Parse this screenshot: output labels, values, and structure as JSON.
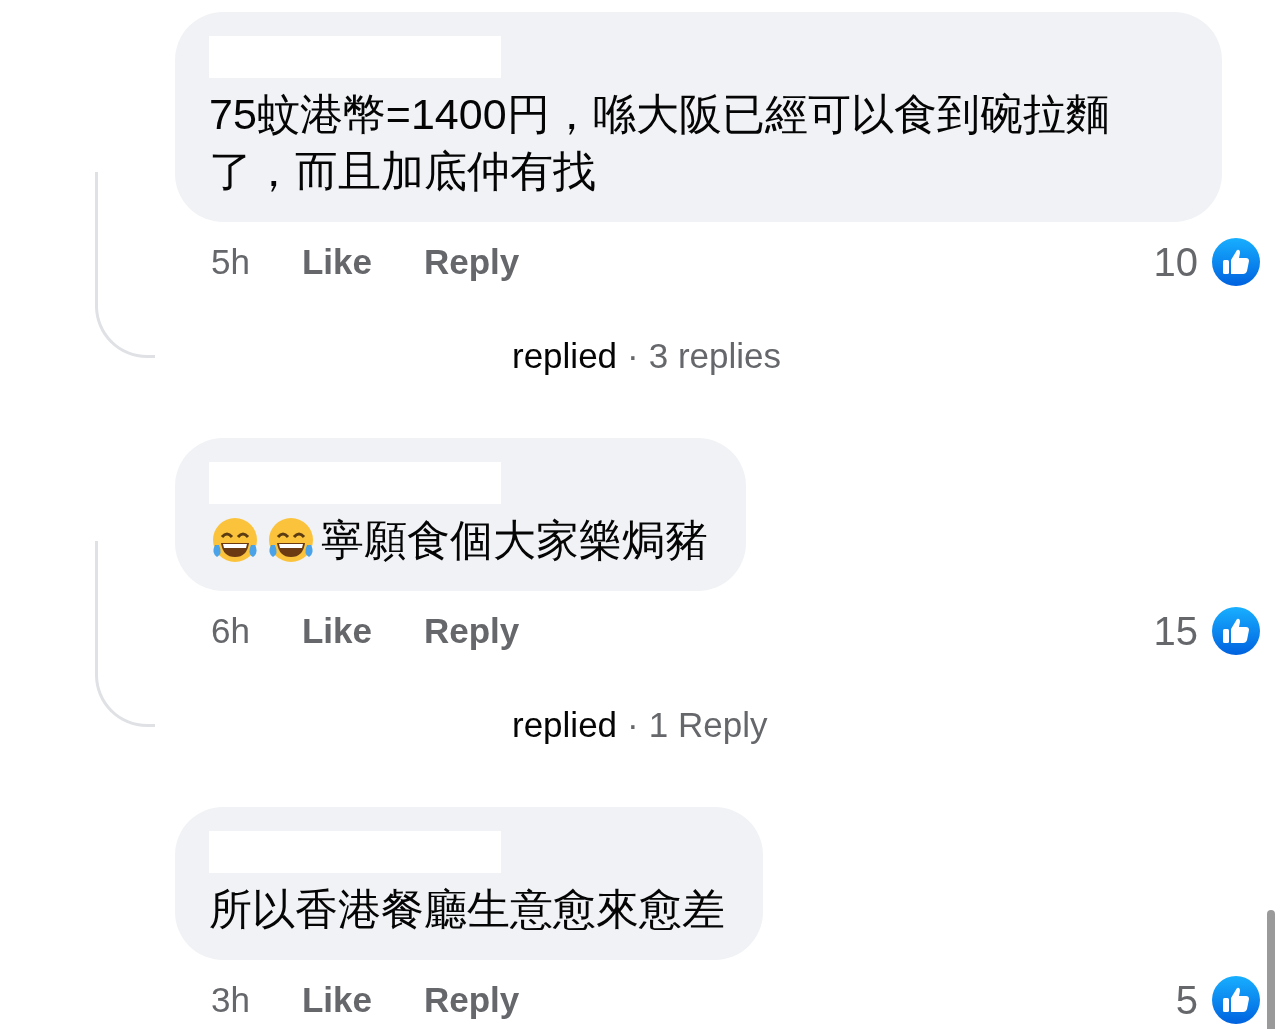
{
  "comments": [
    {
      "author_hidden": true,
      "text": "75蚊港幣=1400円，喺大阪已經可以食到碗拉麵了，而且加底仲有找",
      "time": "5h",
      "like_label": "Like",
      "reply_label": "Reply",
      "like_count": "10",
      "replies": {
        "action": "replied",
        "separator": "·",
        "count": "3 replies"
      }
    },
    {
      "author_hidden": true,
      "prefix_icons": [
        {
          "kind": "laughing"
        },
        {
          "kind": "laughing"
        }
      ],
      "text": "寧願食個大家樂焗豬",
      "time": "6h",
      "like_label": "Like",
      "reply_label": "Reply",
      "like_count": "15",
      "replies": {
        "action": "replied",
        "separator": "·",
        "count": "1 Reply"
      }
    },
    {
      "author_hidden": true,
      "text": "所以香港餐廳生意愈來愈差",
      "time": "3h",
      "like_label": "Like",
      "reply_label": "Reply",
      "like_count": "5"
    }
  ]
}
